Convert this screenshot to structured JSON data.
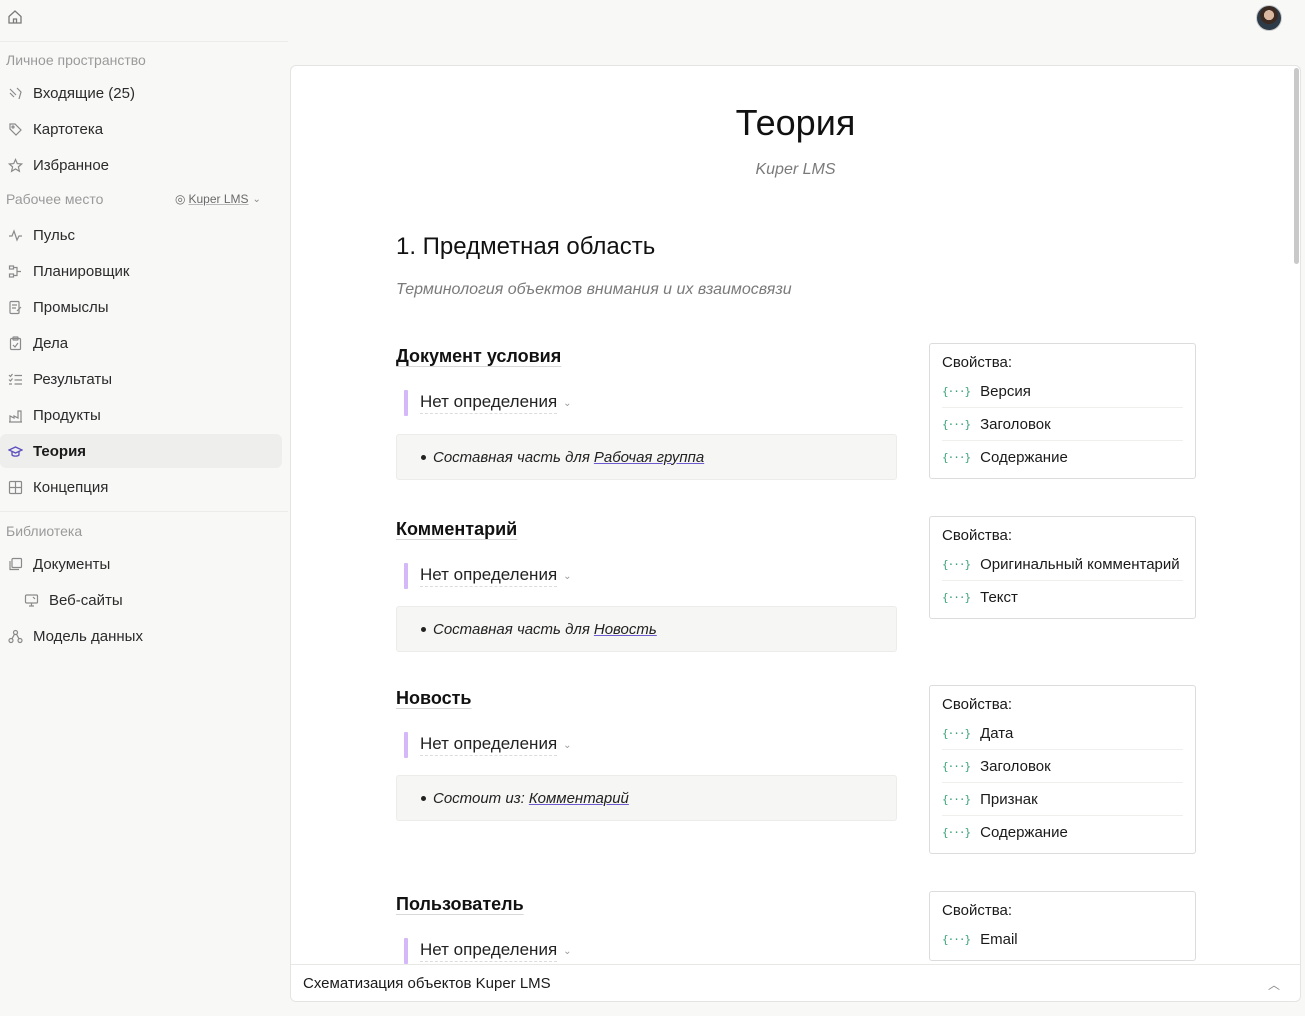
{
  "sidebar": {
    "personal_title": "Личное пространство",
    "personal_items": [
      {
        "label": "Входящие (25)",
        "icon": "inbox-icon"
      },
      {
        "label": "Картотека",
        "icon": "tag-icon"
      },
      {
        "label": "Избранное",
        "icon": "star-icon"
      }
    ],
    "workspace_title": "Рабочее место",
    "workspace_name": "Kuper LMS",
    "workspace_items": [
      {
        "label": "Пульс",
        "icon": "pulse-icon"
      },
      {
        "label": "Планировщик",
        "icon": "planner-icon"
      },
      {
        "label": "Промыслы",
        "icon": "crafts-icon"
      },
      {
        "label": "Дела",
        "icon": "clipboard-icon"
      },
      {
        "label": "Результаты",
        "icon": "checklist-icon"
      },
      {
        "label": "Продукты",
        "icon": "factory-icon"
      },
      {
        "label": "Теория",
        "icon": "graduation-cap-icon"
      },
      {
        "label": "Концепция",
        "icon": "layout-icon"
      }
    ],
    "library_title": "Библиотека",
    "library_items": [
      {
        "label": "Документы",
        "icon": "documents-icon"
      },
      {
        "label": "Веб-сайты",
        "icon": "monitor-icon"
      },
      {
        "label": "Модель данных",
        "icon": "data-model-icon"
      }
    ]
  },
  "doc": {
    "title": "Теория",
    "subtitle": "Kuper LMS",
    "section_title": "1. Предметная область",
    "section_subtitle": "Терминология объектов внимания и их взаимосвязи",
    "props_label": "Свойства:",
    "definition_label": "Нет определения",
    "entities": [
      {
        "name": "Документ условия",
        "relation_prefix": "Составная часть для",
        "relation_link": "Рабочая группа",
        "properties": [
          "Версия",
          "Заголовок",
          "Содержание"
        ]
      },
      {
        "name": "Комментарий",
        "relation_prefix": "Составная часть для",
        "relation_link": "Новость",
        "properties": [
          "Оригинальный комментарий",
          "Текст"
        ]
      },
      {
        "name": "Новость",
        "relation_prefix": "Состоит из:",
        "relation_link": "Комментарий",
        "properties": [
          "Дата",
          "Заголовок",
          "Признак",
          "Содержание"
        ]
      },
      {
        "name": "Пользователь",
        "properties": [
          "Email"
        ]
      }
    ]
  },
  "bottom_bar": {
    "label": "Схематизация объектов Kuper LMS"
  },
  "colors": {
    "accent": "#5b4fbf",
    "definition_bar": "#d4b8f7",
    "property_icon": "#3aa17a"
  }
}
